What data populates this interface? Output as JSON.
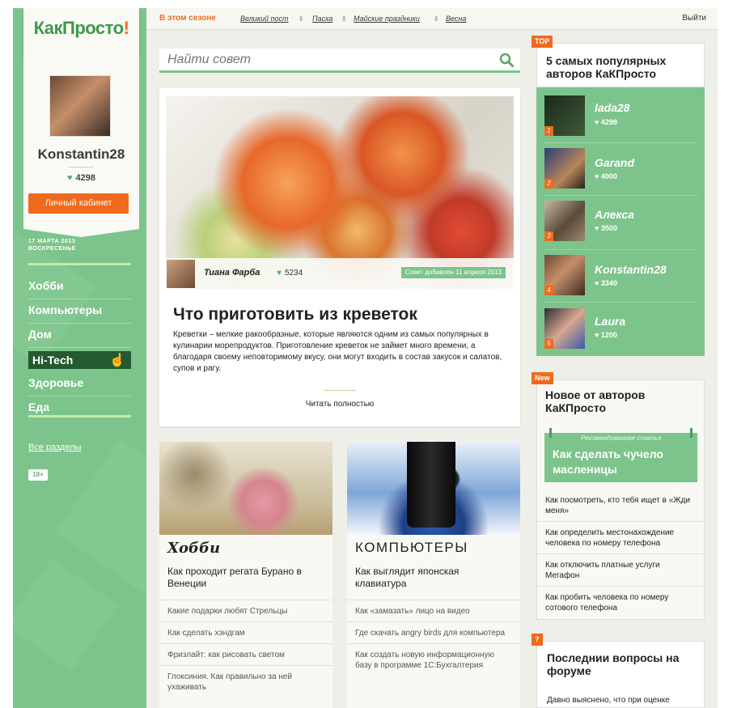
{
  "logo": {
    "part1": "Как",
    "part2": "Просто",
    "part3": "!"
  },
  "profile": {
    "username": "Konstantin28",
    "rating": "4298",
    "cabinet_label": "Личный кабинет"
  },
  "date": {
    "line1": "17 МАРТА 2013",
    "line2": "ВОСКРЕСЕНЬЕ"
  },
  "nav": {
    "items": [
      "Хобби",
      "Компьютеры",
      "Дом",
      "Hi-Tech",
      "Здоровье",
      "Еда"
    ],
    "active": "Hi-Tech",
    "all_sections": "Все разделы",
    "age": "18+"
  },
  "topbar": {
    "season": "В этом сезоне",
    "links": [
      "Великий пост",
      "Пасха",
      "Майские праздники",
      "Весна"
    ],
    "logout": "Выйти"
  },
  "search": {
    "placeholder": "Найти совет"
  },
  "article": {
    "author": "Тиана Фарба",
    "rating": "5234",
    "added": "Совет добавлен 11 апреля 2013",
    "title": "Что приготовить из креветок",
    "text": "Креветки – мелкие ракообразные, которые являются одним из самых популярных в кулинарии морепродуктов. Приготовление креветок не займет много времени, а благодаря своему неповторимому вкусу, они могут входить в состав закусок и салатов, супов и рагу.",
    "read_more": "Читать полностью"
  },
  "cards": [
    {
      "category": "Хобби",
      "title": "Как проходит регата Бурано в Венеции",
      "items": [
        "Какие подарки любят Стрельцы",
        "Как сделать хэндгам",
        "Фризлайт: как рисовать светом",
        "Глоксиния. Как правильно за ней ухаживать"
      ]
    },
    {
      "category": "КОМПЬЮТЕРЫ",
      "title": "Как выглядит японская клавиатура",
      "items": [
        "Как «замазать» лицо на видео",
        "Где скачать angry birds для компьютера",
        "Как создать новую информационную базу в программе 1С:Бухгалтерия"
      ]
    }
  ],
  "top_authors": {
    "badge": "TOP",
    "title": "5 самых популярных авторов КаКПросто",
    "authors": [
      {
        "rank": "1",
        "name": "lada28",
        "rating": "4298"
      },
      {
        "rank": "2",
        "name": "Garand",
        "rating": "4000"
      },
      {
        "rank": "3",
        "name": "Алекса",
        "rating": "3500"
      },
      {
        "rank": "4",
        "name": "Konstantin28",
        "rating": "3340"
      },
      {
        "rank": "5",
        "name": "Laura",
        "rating": "1200"
      }
    ]
  },
  "new_authors": {
    "badge": "New",
    "title": "Новое от авторов КаКПросто",
    "rec_label": "Рекомендованная статья",
    "rec_title": "Как сделать чучело масленицы",
    "items": [
      "Как посмотреть, кто тебя ищет в «Жди меня»",
      "Как определить местонахождение человека по номеру телефона",
      "Как отключить платные услуги Мегафон",
      "Как пробить человека по номеру сотового телефона"
    ]
  },
  "forum": {
    "badge": "?",
    "title": "Последнии вопросы на форуме",
    "text": "Давно выяснено, что при оценке"
  },
  "colors": {
    "green": "#7cc48b",
    "orange": "#f06a1d",
    "dark_green": "#245a2f"
  }
}
